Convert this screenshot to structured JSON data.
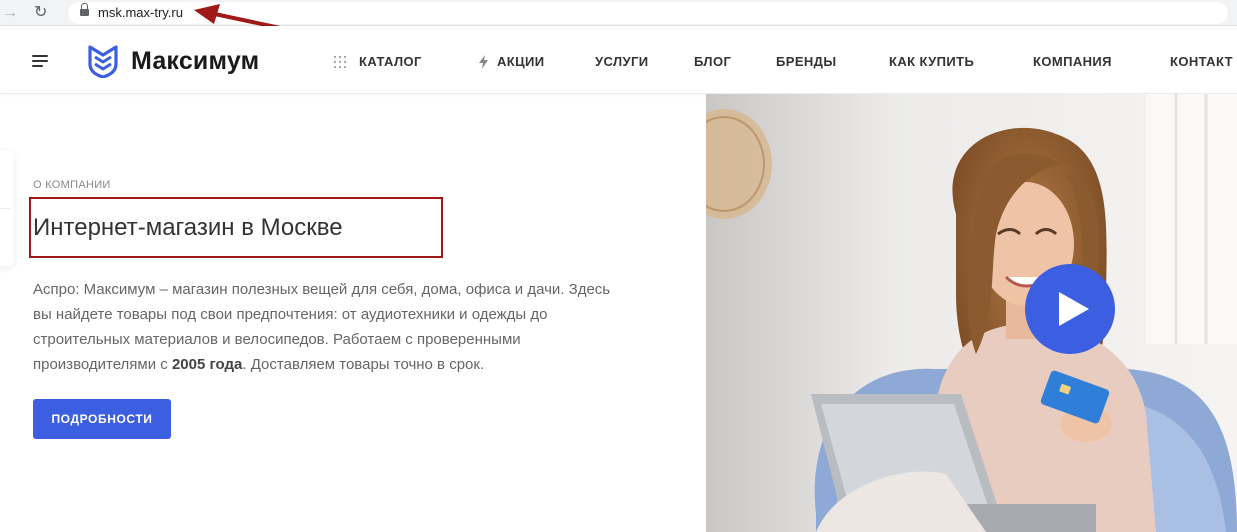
{
  "browser": {
    "back_icon": "arrow-left-icon",
    "reload_icon": "reload-icon",
    "url": "msk.max-try.ru"
  },
  "header": {
    "brand": "Максимум",
    "nav": [
      {
        "label": "Каталог",
        "icon": "grid-icon"
      },
      {
        "label": "Акции",
        "icon": "bolt-icon"
      },
      {
        "label": "Услуги"
      },
      {
        "label": "Блог"
      },
      {
        "label": "Бренды"
      },
      {
        "label": "Как купить"
      },
      {
        "label": "Компания"
      },
      {
        "label": "Контакт"
      }
    ]
  },
  "content": {
    "overline": "О компании",
    "title": "Интернет-магазин в Москве",
    "description_before": "Аспро: Максимум – магазин полезных вещей для себя, дома, офиса и дачи. Здесь вы найдете товары под свои предпочтения: от аудиотехники и одежды до строительных материалов и велосипедов. Работаем с проверенными производителями с ",
    "description_bold": "2005 года",
    "description_after": ". Доставляем товары точно в срок.",
    "button": "Подробности"
  },
  "hero": {
    "play_icon": "play-icon"
  },
  "colors": {
    "accent": "#3b5fe0",
    "annotation": "#a01818"
  }
}
